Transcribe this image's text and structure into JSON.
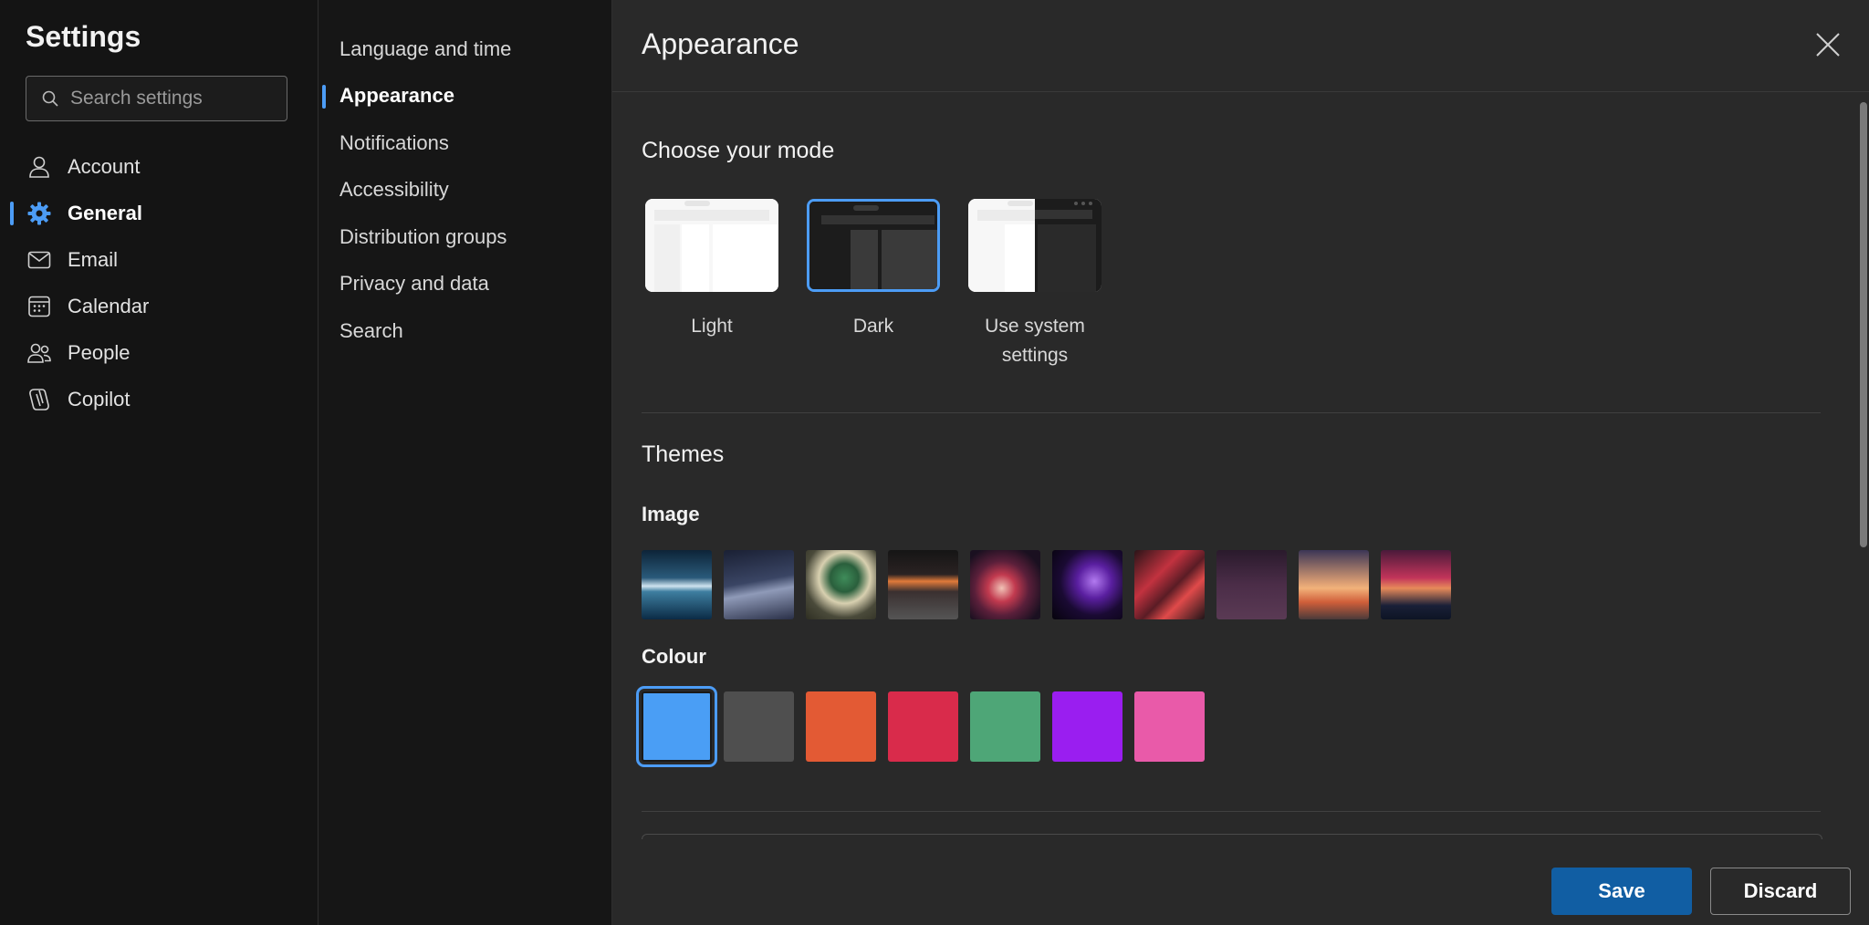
{
  "settings": {
    "title": "Settings",
    "search_placeholder": "Search settings"
  },
  "nav": {
    "items": [
      {
        "label": "Account",
        "icon": "person-icon"
      },
      {
        "label": "General",
        "icon": "gear-icon",
        "active": true
      },
      {
        "label": "Email",
        "icon": "mail-icon"
      },
      {
        "label": "Calendar",
        "icon": "calendar-icon"
      },
      {
        "label": "People",
        "icon": "people-icon"
      },
      {
        "label": "Copilot",
        "icon": "copilot-icon"
      }
    ]
  },
  "subnav": {
    "items": [
      {
        "label": "Language and time"
      },
      {
        "label": "Appearance",
        "active": true
      },
      {
        "label": "Notifications"
      },
      {
        "label": "Accessibility"
      },
      {
        "label": "Distribution groups"
      },
      {
        "label": "Privacy and data"
      },
      {
        "label": "Search"
      }
    ]
  },
  "main": {
    "title": "Appearance",
    "mode_section": "Choose your mode",
    "modes": [
      {
        "label": "Light"
      },
      {
        "label": "Dark",
        "selected": true
      },
      {
        "label": "Use system settings"
      }
    ],
    "themes_section": "Themes",
    "image_label": "Image",
    "colour_label": "Colour",
    "colours": [
      "#4a9ef5",
      "#4f4f4f",
      "#e35a34",
      "#d92b4b",
      "#4ea677",
      "#9a1ef0",
      "#e95aa9"
    ],
    "selected_colour": "#4a9ef5"
  },
  "footer": {
    "save_label": "Save",
    "discard_label": "Discard"
  },
  "accent": "#4c9cf5"
}
